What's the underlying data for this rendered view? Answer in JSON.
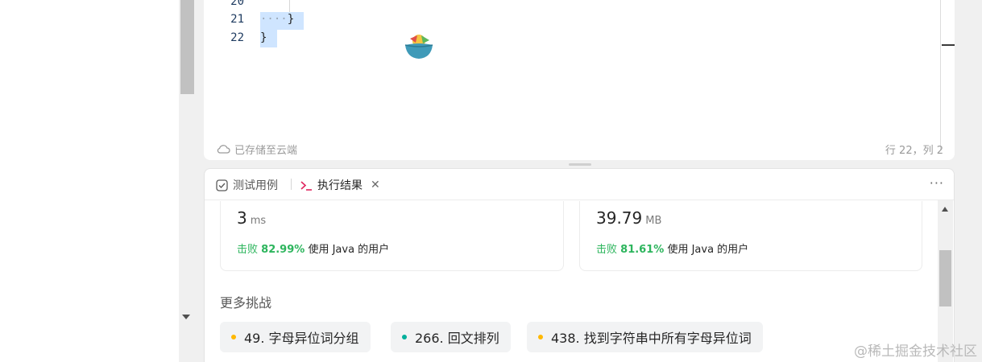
{
  "editor": {
    "lines": [
      {
        "num": "20",
        "dots": "",
        "text": ""
      },
      {
        "num": "21",
        "dots": "····",
        "text": "}"
      },
      {
        "num": "22",
        "dots": "",
        "text": "}"
      }
    ],
    "saved_status": "已存储至云端",
    "cursor_position": "行 22，列 2"
  },
  "result": {
    "tabs": [
      {
        "label": "测试用例",
        "icon": "checkbox-icon"
      },
      {
        "label": "执行结果",
        "icon": "terminal-icon"
      }
    ],
    "more_label": "···",
    "runtime": {
      "value": "3",
      "unit": "ms",
      "beat_prefix": "击败",
      "beat_percent": "82.99%",
      "beat_suffix": "使用 Java 的用户"
    },
    "memory": {
      "value": "39.79",
      "unit": "MB",
      "beat_prefix": "击败",
      "beat_percent": "81.61%",
      "beat_suffix": "使用 Java 的用户"
    },
    "more_challenges_title": "更多挑战",
    "challenges": [
      {
        "label": "49. 字母异位词分组",
        "difficulty_color": "#ffb800"
      },
      {
        "label": "266. 回文排列",
        "difficulty_color": "#00af9b"
      },
      {
        "label": "438. 找到字符串中所有字母异位词",
        "difficulty_color": "#ffb800"
      }
    ]
  },
  "watermark": "@稀土掘金技术社区",
  "colors": {
    "beat_green": "#2db55d",
    "tab_icon_red": "#e0245e",
    "selection": "#cfe5ff"
  }
}
